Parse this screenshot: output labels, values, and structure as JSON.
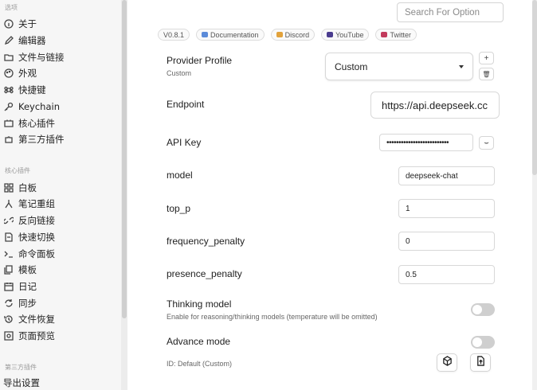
{
  "sidebar": {
    "section_options": "选项",
    "options_items": [
      {
        "label": "关于",
        "icon": "info-circle-icon"
      },
      {
        "label": "编辑器",
        "icon": "pencil-icon"
      },
      {
        "label": "文件与链接",
        "icon": "folder-link-icon"
      },
      {
        "label": "外观",
        "icon": "palette-icon"
      },
      {
        "label": "快捷键",
        "icon": "command-icon"
      },
      {
        "label": "Keychain",
        "icon": "key-icon"
      },
      {
        "label": "核心插件",
        "icon": "plug-icon"
      },
      {
        "label": "第三方插件",
        "icon": "puzzle-icon"
      }
    ],
    "section_core": "核心插件",
    "core_items": [
      {
        "label": "白板",
        "icon": "grid-icon"
      },
      {
        "label": "笔记重组",
        "icon": "merge-icon"
      },
      {
        "label": "反向链接",
        "icon": "backlink-icon"
      },
      {
        "label": "快速切换",
        "icon": "switch-icon"
      },
      {
        "label": "命令面板",
        "icon": "terminal-icon"
      },
      {
        "label": "模板",
        "icon": "template-icon"
      },
      {
        "label": "日记",
        "icon": "calendar-icon"
      },
      {
        "label": "同步",
        "icon": "sync-icon"
      },
      {
        "label": "文件恢复",
        "icon": "history-icon"
      },
      {
        "label": "页面预览",
        "icon": "preview-icon"
      }
    ],
    "section_third": "第三方插件",
    "third_items": [
      {
        "label": "导出设置"
      }
    ]
  },
  "main": {
    "search": {
      "placeholder": "Search For Option"
    },
    "chips": [
      {
        "label": "V0.8.1",
        "icon": ""
      },
      {
        "label": "Documentation",
        "icon": "book-icon"
      },
      {
        "label": "Discord",
        "icon": "discord-icon"
      },
      {
        "label": "YouTube",
        "icon": "youtube-icon"
      },
      {
        "label": "Twitter",
        "icon": "twitter-icon"
      }
    ],
    "provider": {
      "label": "Provider Profile",
      "sub": "Custom",
      "value": "Custom",
      "add": "+",
      "delete": "🗑"
    },
    "endpoint": {
      "label": "Endpoint",
      "value": "https://api.deepseek.cc"
    },
    "api_key": {
      "label": "API Key",
      "value": "••••••••••••••••••••••••••",
      "reveal": "⌣"
    },
    "model": {
      "label": "model",
      "value": "deepseek-chat"
    },
    "top_p": {
      "label": "top_p",
      "value": "1"
    },
    "frequency_penalty": {
      "label": "frequency_penalty",
      "value": "0"
    },
    "presence_penalty": {
      "label": "presence_penalty",
      "value": "0.5"
    },
    "thinking": {
      "label": "Thinking model",
      "sub": "Enable for reasoning/thinking models (temperature will be omitted)",
      "enabled": false
    },
    "advance": {
      "label": "Advance mode",
      "enabled": false
    },
    "id_text": "ID: Default (Custom)"
  },
  "colors": {
    "accent": "#7b5cd6",
    "toggle_off": "#cfcfcf",
    "sidebar_bg": "#f6f6f6"
  }
}
